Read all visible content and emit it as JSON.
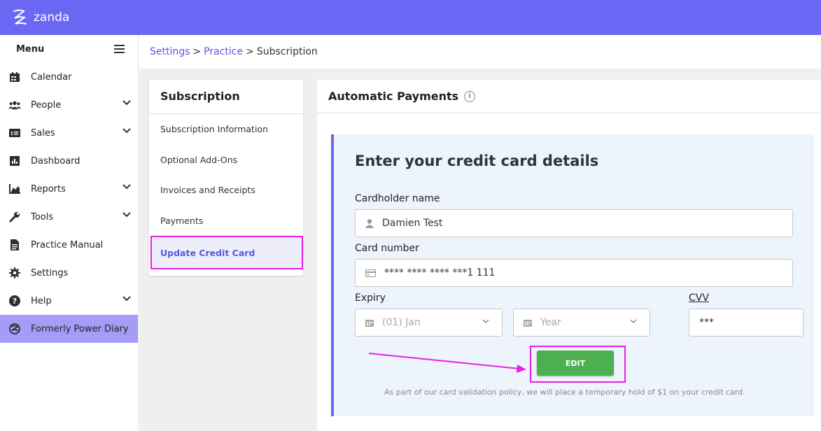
{
  "app": {
    "name": "zanda"
  },
  "sidebar": {
    "menu_label": "Menu",
    "items": [
      {
        "label": "Calendar",
        "icon": "calendar-icon",
        "has_chevron": false
      },
      {
        "label": "People",
        "icon": "people-icon",
        "has_chevron": true
      },
      {
        "label": "Sales",
        "icon": "sales-icon",
        "has_chevron": true
      },
      {
        "label": "Dashboard",
        "icon": "dashboard-icon",
        "has_chevron": false
      },
      {
        "label": "Reports",
        "icon": "reports-icon",
        "has_chevron": true
      },
      {
        "label": "Tools",
        "icon": "wrench-icon",
        "has_chevron": true
      },
      {
        "label": "Practice Manual",
        "icon": "document-icon",
        "has_chevron": false
      },
      {
        "label": "Settings",
        "icon": "gear-icon",
        "has_chevron": false
      },
      {
        "label": "Help",
        "icon": "help-icon",
        "has_chevron": true
      },
      {
        "label": "Formerly Power Diary",
        "icon": "power-diary-icon",
        "has_chevron": false
      }
    ]
  },
  "breadcrumb": {
    "items": [
      "Settings",
      "Practice",
      "Subscription"
    ],
    "separator": ">"
  },
  "subscription_menu": {
    "title": "Subscription",
    "items": [
      "Subscription Information",
      "Optional Add-Ons",
      "Invoices and Receipts",
      "Payments",
      "Update Credit Card"
    ]
  },
  "panel": {
    "title": "Automatic Payments",
    "info_glyph": "i",
    "form": {
      "heading": "Enter your credit card details",
      "cardholder_label": "Cardholder name",
      "cardholder_value": "Damien Test",
      "card_number_label": "Card number",
      "card_number_value": "**** **** **** ***1 111",
      "expiry_label": "Expiry",
      "expiry_month": "(01) Jan",
      "expiry_year": "Year",
      "cvv_label": "CVV",
      "cvv_value": "***",
      "edit_label": "EDIT",
      "note": "As part of our card validation policy, we will place a temporary hold of $1 on your credit card."
    }
  },
  "colors": {
    "brand": "#6b67f5",
    "active_nav": "#a59cf7",
    "highlight": "#e620e6",
    "button": "#4caf50"
  }
}
